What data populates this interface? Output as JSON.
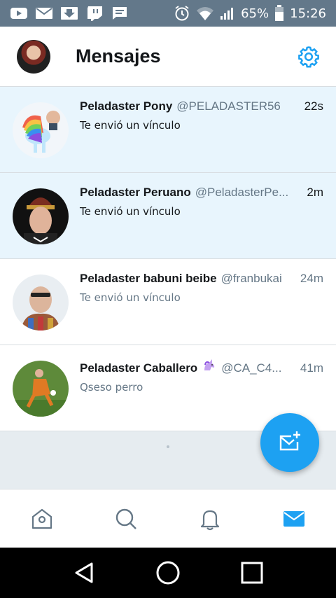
{
  "status_bar": {
    "battery": "65%",
    "time": "15:26",
    "left_icons": [
      "youtube-icon",
      "mail-icon",
      "download-icon",
      "twitch-icon",
      "message-icon"
    ],
    "right_icons": [
      "alarm-icon",
      "wifi-icon",
      "signal-icon",
      "battery-icon"
    ]
  },
  "header": {
    "title": "Mensajes",
    "settings_icon": "gear-icon",
    "accent_color": "#1da1f2"
  },
  "conversations": [
    {
      "name": "Peladaster Pony",
      "handle": "@PELADASTER56",
      "time": "22s",
      "message": "Te envió un vínculo",
      "unread": true
    },
    {
      "name": "Peladaster Peruano",
      "handle": "@PeladasterPe...",
      "time": "2m",
      "message": "Te envió un vínculo",
      "unread": true
    },
    {
      "name": "Peladaster babuni beibe",
      "handle": "@franbukai",
      "time": "24m",
      "message": "Te envió un vínculo",
      "unread": false
    },
    {
      "name": "Peladaster Caballero",
      "name_emoji": "unicorn-icon",
      "handle": "@CA_C4...",
      "time": "41m",
      "message": "Qseso perro",
      "unread": false
    }
  ],
  "fab": {
    "icon": "new-message-icon"
  },
  "tabs": [
    {
      "id": "home",
      "icon": "home-icon",
      "active": false
    },
    {
      "id": "search",
      "icon": "search-icon",
      "active": false
    },
    {
      "id": "notifications",
      "icon": "bell-icon",
      "active": false
    },
    {
      "id": "messages",
      "icon": "envelope-icon",
      "active": true
    }
  ],
  "nav_bar": {
    "icons": [
      "back-icon",
      "home-circle-icon",
      "recents-icon"
    ]
  }
}
